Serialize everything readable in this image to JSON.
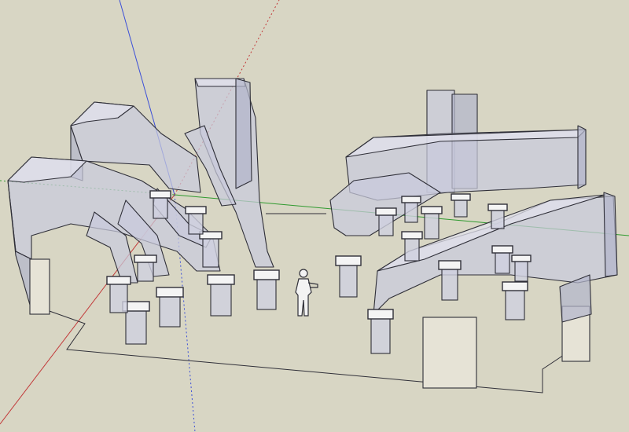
{
  "scene": {
    "background_color": "#d8d6c4",
    "axis_colors": {
      "red": "#c23a3a",
      "green": "#2f9a2f",
      "blue": "#3b4fd8"
    },
    "objects": [
      "hvac-duct-network",
      "human-scale-figure",
      "room-floor-outline",
      "door-panel"
    ]
  }
}
